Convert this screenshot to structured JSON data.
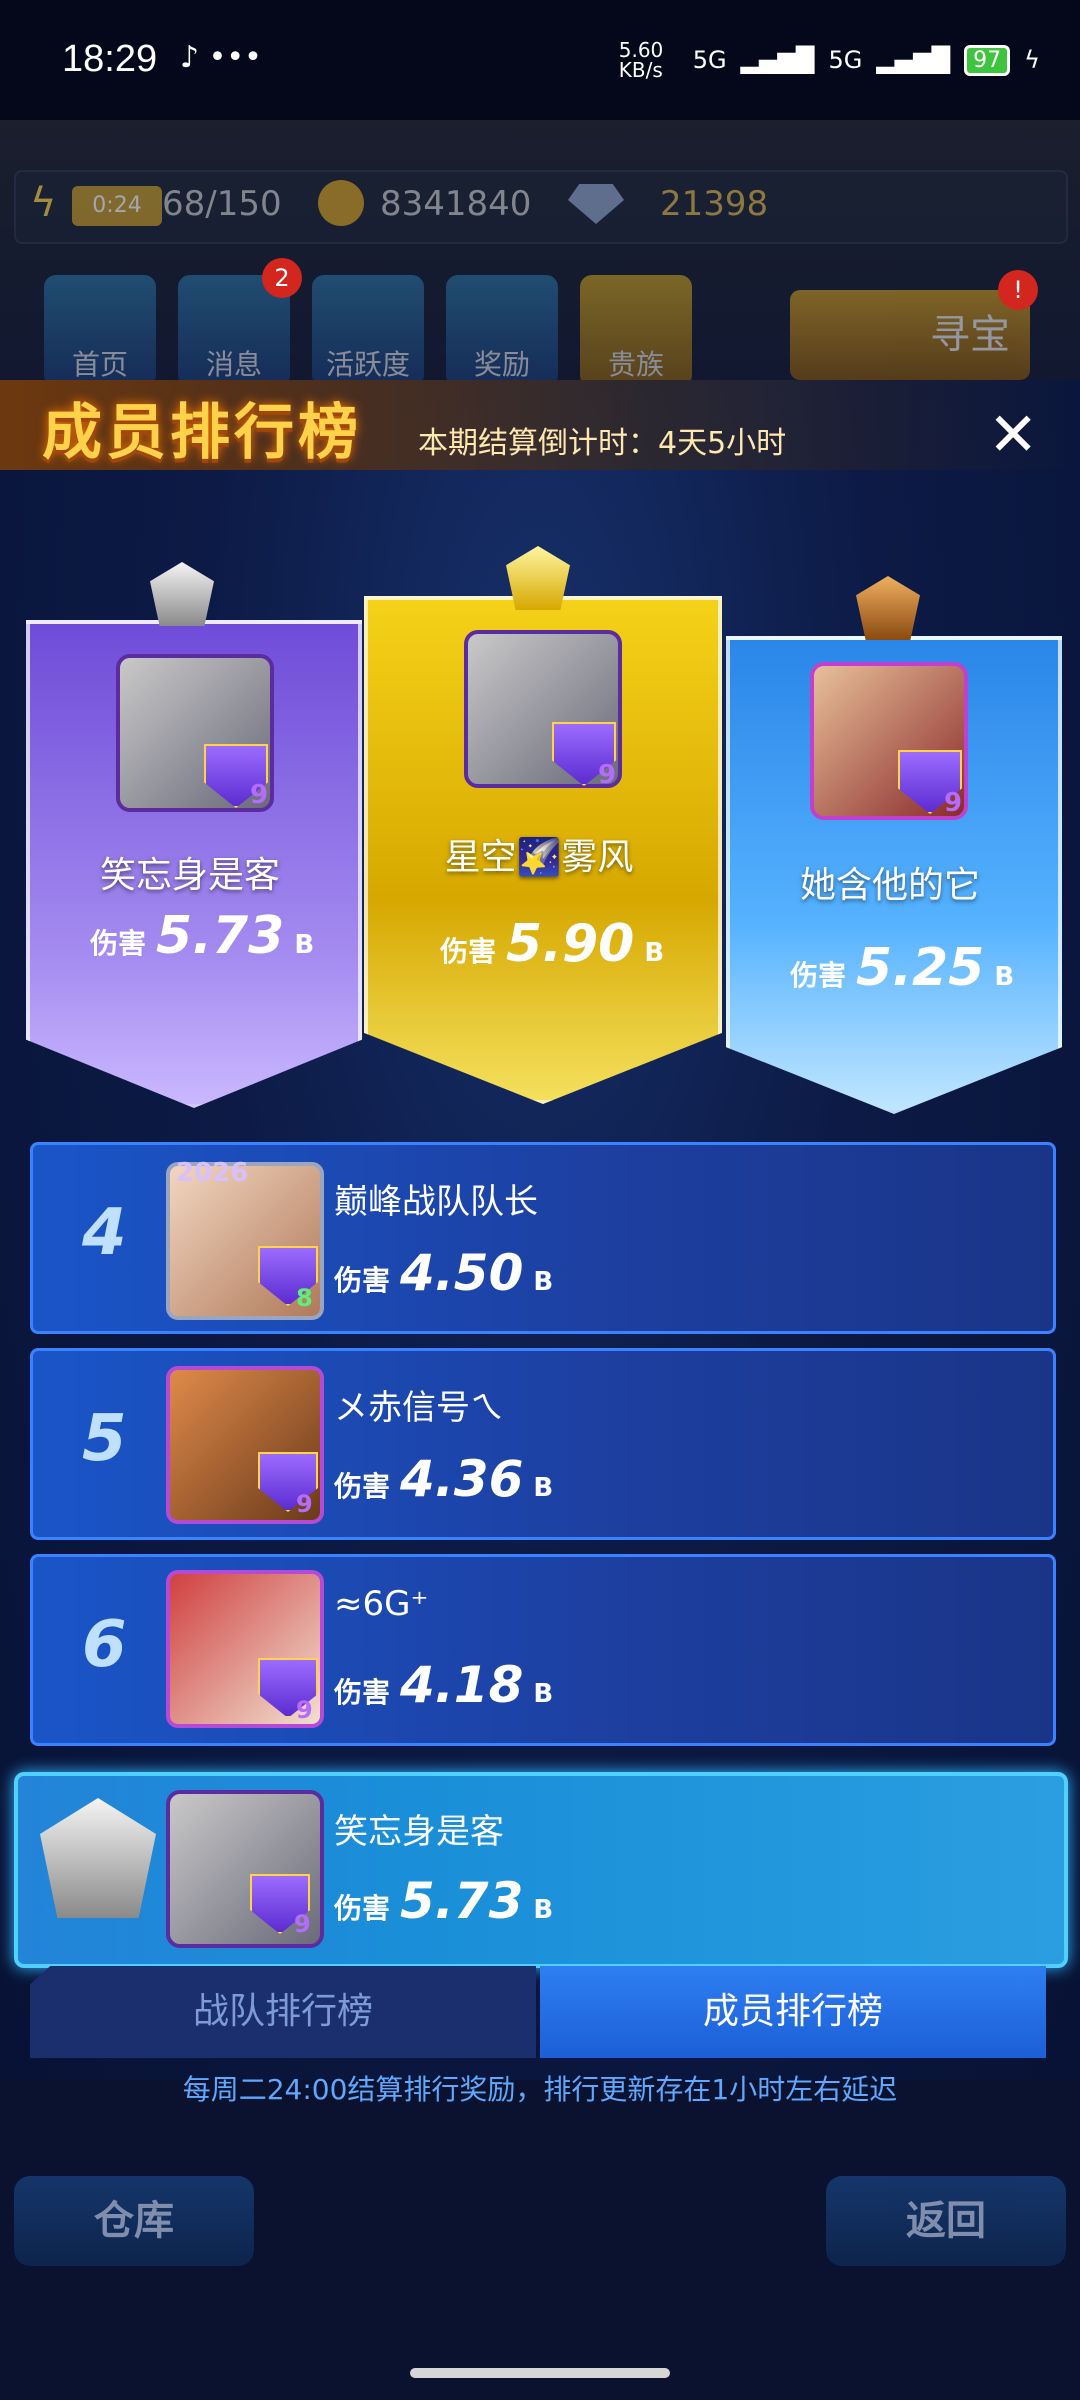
{
  "status_bar": {
    "time": "18:29",
    "net_speed": "5.60 KB/s",
    "signal1": "5G",
    "signal2": "5G",
    "battery": "97"
  },
  "hud": {
    "timer": "0:24",
    "energy": "68/150",
    "gold": "8341840",
    "gems": "21398",
    "buttons": [
      "首页",
      "消息",
      "活跃度",
      "奖励",
      "贵族"
    ],
    "message_badge": "2",
    "treasure": "寻宝",
    "treasure_badge": "!"
  },
  "modal": {
    "title": "成员排行榜",
    "countdown": "本期结算倒计时：4天5小时",
    "close": "✕"
  },
  "podium": [
    {
      "name": "笑忘身是客",
      "damage_label": "伤害",
      "damage": "5.73",
      "unit": "B",
      "level": "9"
    },
    {
      "name": "星空🌠雾风",
      "damage_label": "伤害",
      "damage": "5.90",
      "unit": "B",
      "level": "9"
    },
    {
      "name": "她含他的它",
      "damage_label": "伤害",
      "damage": "5.25",
      "unit": "B",
      "level": "9"
    }
  ],
  "rows": [
    {
      "rank": "4",
      "name": "巅峰战队队长",
      "damage_label": "伤害",
      "damage": "4.50",
      "unit": "B",
      "level": "8",
      "frame": "2026"
    },
    {
      "rank": "5",
      "name": "メ赤信号ㄟ",
      "damage_label": "伤害",
      "damage": "4.36",
      "unit": "B",
      "level": "9"
    },
    {
      "rank": "6",
      "name": "≈6G⁺",
      "damage_label": "伤害",
      "damage": "4.18",
      "unit": "B",
      "level": "9"
    }
  ],
  "my_row": {
    "name": "笑忘身是客",
    "damage_label": "伤害",
    "damage": "5.73",
    "unit": "B",
    "level": "9"
  },
  "tabs": {
    "team": "战队排行榜",
    "member": "成员排行榜"
  },
  "footnote": "每周二24:00结算排行奖励，排行更新存在1小时左右延迟",
  "bottom": {
    "warehouse": "仓库",
    "back": "返回"
  }
}
